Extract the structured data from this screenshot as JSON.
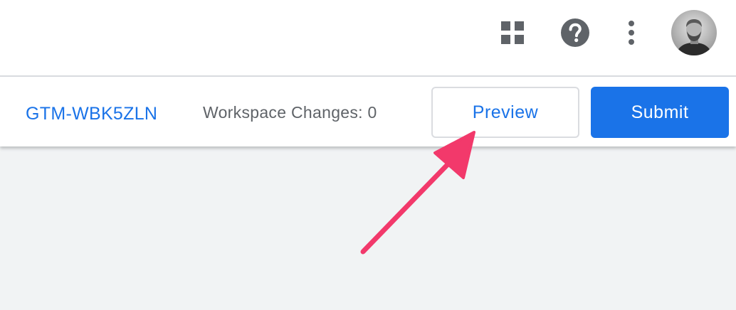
{
  "app_bar": {
    "icons": {
      "apps": "apps-grid-icon",
      "help": "help-icon",
      "more": "more-vert-icon",
      "avatar": "user-avatar"
    }
  },
  "toolbar": {
    "container_id": "GTM-WBK5ZLN",
    "workspace_changes": "Workspace Changes: 0",
    "preview_label": "Preview",
    "submit_label": "Submit"
  },
  "colors": {
    "accent": "#1a73e8",
    "annotation_arrow": "#f2396b",
    "background": "#f1f3f4"
  }
}
